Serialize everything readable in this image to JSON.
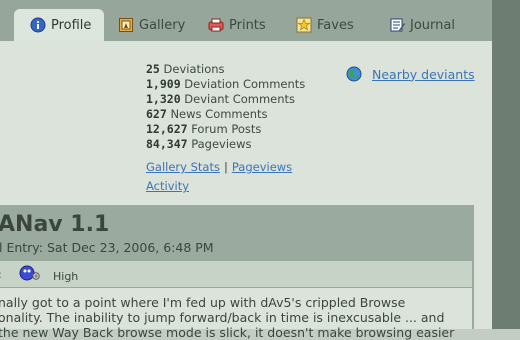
{
  "tabs": [
    {
      "label": "Profile",
      "icon": "info-icon"
    },
    {
      "label": "Gallery",
      "icon": "gallery-icon"
    },
    {
      "label": "Prints",
      "icon": "prints-icon"
    },
    {
      "label": "Faves",
      "icon": "star-icon"
    },
    {
      "label": "Journal",
      "icon": "journal-icon"
    }
  ],
  "stats": [
    {
      "count": "25",
      "label": "Deviations"
    },
    {
      "count": "1,909",
      "label": "Deviation Comments"
    },
    {
      "count": "1,320",
      "label": "Deviant Comments"
    },
    {
      "count": "627",
      "label": "News Comments"
    },
    {
      "count": "12,627",
      "label": "Forum Posts"
    },
    {
      "count": "84,347",
      "label": "Pageviews"
    }
  ],
  "links": {
    "gallery_stats": "Gallery Stats",
    "separator": "|",
    "pageviews": "Pageviews",
    "activity": "Activity"
  },
  "nearby": {
    "label": "Nearby deviants",
    "icon": "globe-icon"
  },
  "journal": {
    "title": "ANav 1.1",
    "date": "l Entry: Sat Dec 23, 2006, 6:48 PM",
    "mood_label": ":",
    "mood_value": "High",
    "mood_icon": "mood-blob-icon",
    "body_line1": "nally got to a point where I'm fed up with dAv5's crippled Browse",
    "body_line2": "onality. The inability to jump forward/back in time is inexcusable ... and",
    "body_line3": "the new Way Back browse mode is slick, it doesn't make browsing easier"
  },
  "colors": {
    "link": "#3b74b7",
    "tab_bar": "#96a69b",
    "panel": "#dbe3db",
    "journal_header": "#9aaa9f"
  }
}
